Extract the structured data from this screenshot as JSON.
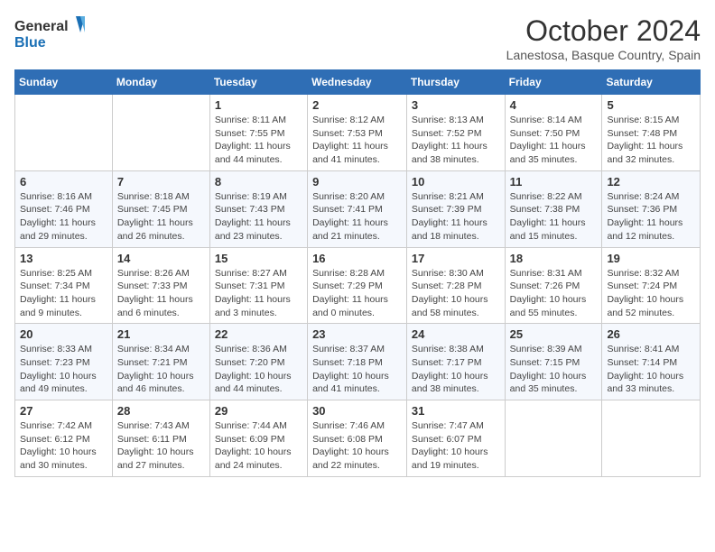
{
  "header": {
    "logo_general": "General",
    "logo_blue": "Blue",
    "month_title": "October 2024",
    "location": "Lanestosa, Basque Country, Spain"
  },
  "weekdays": [
    "Sunday",
    "Monday",
    "Tuesday",
    "Wednesday",
    "Thursday",
    "Friday",
    "Saturday"
  ],
  "weeks": [
    [
      {
        "day": "",
        "sunrise": "",
        "sunset": "",
        "daylight": ""
      },
      {
        "day": "",
        "sunrise": "",
        "sunset": "",
        "daylight": ""
      },
      {
        "day": "1",
        "sunrise": "Sunrise: 8:11 AM",
        "sunset": "Sunset: 7:55 PM",
        "daylight": "Daylight: 11 hours and 44 minutes."
      },
      {
        "day": "2",
        "sunrise": "Sunrise: 8:12 AM",
        "sunset": "Sunset: 7:53 PM",
        "daylight": "Daylight: 11 hours and 41 minutes."
      },
      {
        "day": "3",
        "sunrise": "Sunrise: 8:13 AM",
        "sunset": "Sunset: 7:52 PM",
        "daylight": "Daylight: 11 hours and 38 minutes."
      },
      {
        "day": "4",
        "sunrise": "Sunrise: 8:14 AM",
        "sunset": "Sunset: 7:50 PM",
        "daylight": "Daylight: 11 hours and 35 minutes."
      },
      {
        "day": "5",
        "sunrise": "Sunrise: 8:15 AM",
        "sunset": "Sunset: 7:48 PM",
        "daylight": "Daylight: 11 hours and 32 minutes."
      }
    ],
    [
      {
        "day": "6",
        "sunrise": "Sunrise: 8:16 AM",
        "sunset": "Sunset: 7:46 PM",
        "daylight": "Daylight: 11 hours and 29 minutes."
      },
      {
        "day": "7",
        "sunrise": "Sunrise: 8:18 AM",
        "sunset": "Sunset: 7:45 PM",
        "daylight": "Daylight: 11 hours and 26 minutes."
      },
      {
        "day": "8",
        "sunrise": "Sunrise: 8:19 AM",
        "sunset": "Sunset: 7:43 PM",
        "daylight": "Daylight: 11 hours and 23 minutes."
      },
      {
        "day": "9",
        "sunrise": "Sunrise: 8:20 AM",
        "sunset": "Sunset: 7:41 PM",
        "daylight": "Daylight: 11 hours and 21 minutes."
      },
      {
        "day": "10",
        "sunrise": "Sunrise: 8:21 AM",
        "sunset": "Sunset: 7:39 PM",
        "daylight": "Daylight: 11 hours and 18 minutes."
      },
      {
        "day": "11",
        "sunrise": "Sunrise: 8:22 AM",
        "sunset": "Sunset: 7:38 PM",
        "daylight": "Daylight: 11 hours and 15 minutes."
      },
      {
        "day": "12",
        "sunrise": "Sunrise: 8:24 AM",
        "sunset": "Sunset: 7:36 PM",
        "daylight": "Daylight: 11 hours and 12 minutes."
      }
    ],
    [
      {
        "day": "13",
        "sunrise": "Sunrise: 8:25 AM",
        "sunset": "Sunset: 7:34 PM",
        "daylight": "Daylight: 11 hours and 9 minutes."
      },
      {
        "day": "14",
        "sunrise": "Sunrise: 8:26 AM",
        "sunset": "Sunset: 7:33 PM",
        "daylight": "Daylight: 11 hours and 6 minutes."
      },
      {
        "day": "15",
        "sunrise": "Sunrise: 8:27 AM",
        "sunset": "Sunset: 7:31 PM",
        "daylight": "Daylight: 11 hours and 3 minutes."
      },
      {
        "day": "16",
        "sunrise": "Sunrise: 8:28 AM",
        "sunset": "Sunset: 7:29 PM",
        "daylight": "Daylight: 11 hours and 0 minutes."
      },
      {
        "day": "17",
        "sunrise": "Sunrise: 8:30 AM",
        "sunset": "Sunset: 7:28 PM",
        "daylight": "Daylight: 10 hours and 58 minutes."
      },
      {
        "day": "18",
        "sunrise": "Sunrise: 8:31 AM",
        "sunset": "Sunset: 7:26 PM",
        "daylight": "Daylight: 10 hours and 55 minutes."
      },
      {
        "day": "19",
        "sunrise": "Sunrise: 8:32 AM",
        "sunset": "Sunset: 7:24 PM",
        "daylight": "Daylight: 10 hours and 52 minutes."
      }
    ],
    [
      {
        "day": "20",
        "sunrise": "Sunrise: 8:33 AM",
        "sunset": "Sunset: 7:23 PM",
        "daylight": "Daylight: 10 hours and 49 minutes."
      },
      {
        "day": "21",
        "sunrise": "Sunrise: 8:34 AM",
        "sunset": "Sunset: 7:21 PM",
        "daylight": "Daylight: 10 hours and 46 minutes."
      },
      {
        "day": "22",
        "sunrise": "Sunrise: 8:36 AM",
        "sunset": "Sunset: 7:20 PM",
        "daylight": "Daylight: 10 hours and 44 minutes."
      },
      {
        "day": "23",
        "sunrise": "Sunrise: 8:37 AM",
        "sunset": "Sunset: 7:18 PM",
        "daylight": "Daylight: 10 hours and 41 minutes."
      },
      {
        "day": "24",
        "sunrise": "Sunrise: 8:38 AM",
        "sunset": "Sunset: 7:17 PM",
        "daylight": "Daylight: 10 hours and 38 minutes."
      },
      {
        "day": "25",
        "sunrise": "Sunrise: 8:39 AM",
        "sunset": "Sunset: 7:15 PM",
        "daylight": "Daylight: 10 hours and 35 minutes."
      },
      {
        "day": "26",
        "sunrise": "Sunrise: 8:41 AM",
        "sunset": "Sunset: 7:14 PM",
        "daylight": "Daylight: 10 hours and 33 minutes."
      }
    ],
    [
      {
        "day": "27",
        "sunrise": "Sunrise: 7:42 AM",
        "sunset": "Sunset: 6:12 PM",
        "daylight": "Daylight: 10 hours and 30 minutes."
      },
      {
        "day": "28",
        "sunrise": "Sunrise: 7:43 AM",
        "sunset": "Sunset: 6:11 PM",
        "daylight": "Daylight: 10 hours and 27 minutes."
      },
      {
        "day": "29",
        "sunrise": "Sunrise: 7:44 AM",
        "sunset": "Sunset: 6:09 PM",
        "daylight": "Daylight: 10 hours and 24 minutes."
      },
      {
        "day": "30",
        "sunrise": "Sunrise: 7:46 AM",
        "sunset": "Sunset: 6:08 PM",
        "daylight": "Daylight: 10 hours and 22 minutes."
      },
      {
        "day": "31",
        "sunrise": "Sunrise: 7:47 AM",
        "sunset": "Sunset: 6:07 PM",
        "daylight": "Daylight: 10 hours and 19 minutes."
      },
      {
        "day": "",
        "sunrise": "",
        "sunset": "",
        "daylight": ""
      },
      {
        "day": "",
        "sunrise": "",
        "sunset": "",
        "daylight": ""
      }
    ]
  ]
}
